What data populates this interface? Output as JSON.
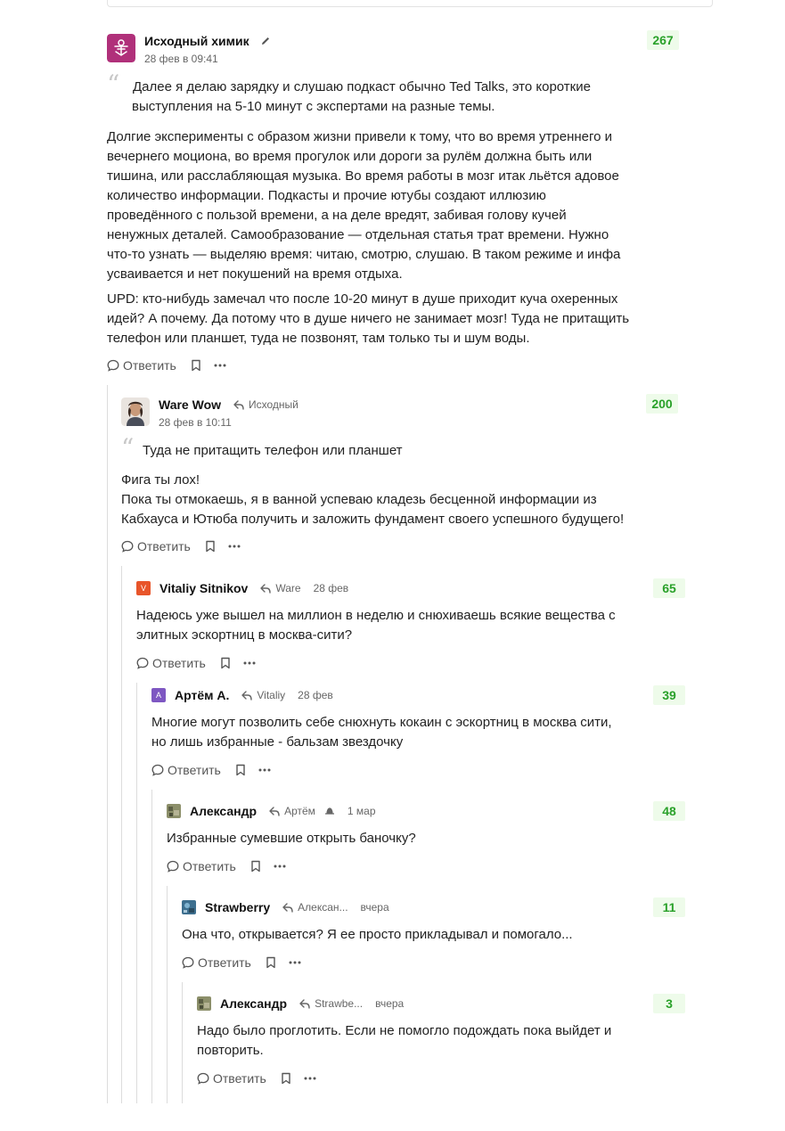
{
  "actions": {
    "reply_label": "Ответить"
  },
  "colors": {
    "score_bg": "#eefbea",
    "score_text": "#2aa12a",
    "thread_line": "#dcdcdc"
  },
  "comments": [
    {
      "author": "Исходный химик",
      "date": "28 фев в 09:41",
      "score": "267",
      "quote_lines": [
        "Далее я делаю зарядку и слушаю подкаст обычно Ted Talks, это короткие",
        "выступления на 5-10 минут с экспертами на разные темы."
      ],
      "paragraphs": [
        [
          "Долгие эксперименты с образом жизни привели к тому, что во время утреннего и",
          "вечернего моциона, во время прогулок или дороги за рулём должна быть или",
          "тишина, или расслабляющая музыка. Во время работы в мозг итак льётся адовое",
          "количество информации. Подкасты и прочие ютубы создают иллюзию",
          "проведённого с пользой времени, а на деле вредят, забивая голову кучей",
          "ненужных деталей. Самообразование — отдельная статья трат времени. Нужно",
          "что-то узнать — выделяю время: читаю, смотрю, слушаю. В таком режиме и инфа",
          "усваивается и нет покушений на время отдыха."
        ],
        [
          "UPD: кто-нибудь замечал что после 10-20 минут в душе приходит куча охеренных",
          "идей? А почему. Да потому что в душе ничего не занимает мозг! Туда не притащить",
          "телефон или планшет, туда не позвонят, там только ты и шум воды."
        ]
      ]
    },
    {
      "author": "Ware Wow",
      "reply_to": "Исходный",
      "date": "28 фев в 10:11",
      "score": "200",
      "quote_lines": [
        "Туда не притащить телефон или планшет"
      ],
      "paragraphs": [
        [
          "Фига ты лох!",
          "Пока ты отмокаешь, я в ванной успеваю кладезь бесценной информации из",
          "Кабхауса и Ютюба получить и заложить фундамент своего успешного будущего!"
        ]
      ]
    },
    {
      "author": "Vitaliy Sitnikov",
      "avatar_letter": "V",
      "reply_to": "Ware",
      "date": "28 фев",
      "score": "65",
      "paragraphs": [
        [
          "Надеюсь уже вышел на миллион в неделю и снюхиваешь всякие вещества с",
          "элитных эскортниц в москва-сити?"
        ]
      ]
    },
    {
      "author": "Артём А.",
      "avatar_letter": "A",
      "reply_to": "Vitaliy",
      "date": "28 фев",
      "score": "39",
      "paragraphs": [
        [
          "Многие могут позволить себе снюхнуть кокаин с эскортниц в москва сити,",
          "но лишь избранные - бальзам звездочку"
        ]
      ]
    },
    {
      "author": "Александр",
      "reply_to": "Артём",
      "date": "1 мар",
      "score": "48",
      "paragraphs": [
        [
          "Избранные сумевшие открыть баночку?"
        ]
      ]
    },
    {
      "author": "Strawberry",
      "reply_to": "Алексан...",
      "date": "вчера",
      "score": "11",
      "paragraphs": [
        [
          "Она что, открывается? Я ее просто прикладывал и помогало..."
        ]
      ]
    },
    {
      "author": "Александр",
      "reply_to": "Strawbe...",
      "date": "вчера",
      "score": "3",
      "paragraphs": [
        [
          "Надо было проглотить. Если не помогло подождать пока выйдет и",
          "повторить."
        ]
      ]
    }
  ]
}
